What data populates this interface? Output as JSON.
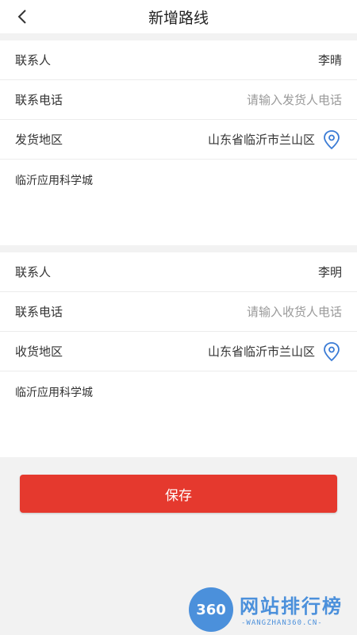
{
  "header": {
    "title": "新增路线",
    "back_icon": "chevron-left-icon"
  },
  "sender": {
    "contact_label": "联系人",
    "contact_value": "李晴",
    "phone_label": "联系电话",
    "phone_value": "",
    "phone_placeholder": "请输入发货人电话",
    "region_label": "发货地区",
    "region_value": "山东省临沂市兰山区",
    "region_icon": "location-pin-icon",
    "address": "临沂应用科学城"
  },
  "receiver": {
    "contact_label": "联系人",
    "contact_value": "李明",
    "phone_label": "联系电话",
    "phone_value": "",
    "phone_placeholder": "请输入收货人电话",
    "region_label": "收货地区",
    "region_value": "山东省临沂市兰山区",
    "region_icon": "location-pin-icon",
    "address": "临沂应用科学城"
  },
  "save_label": "保存",
  "watermark": {
    "logo_text": "360",
    "title": "网站排行榜",
    "subtitle": "-WANGZHAN360.CN-"
  },
  "colors": {
    "primary_button": "#e5392e",
    "pin_icon": "#3a7bd5",
    "background": "#f2f2f2"
  }
}
